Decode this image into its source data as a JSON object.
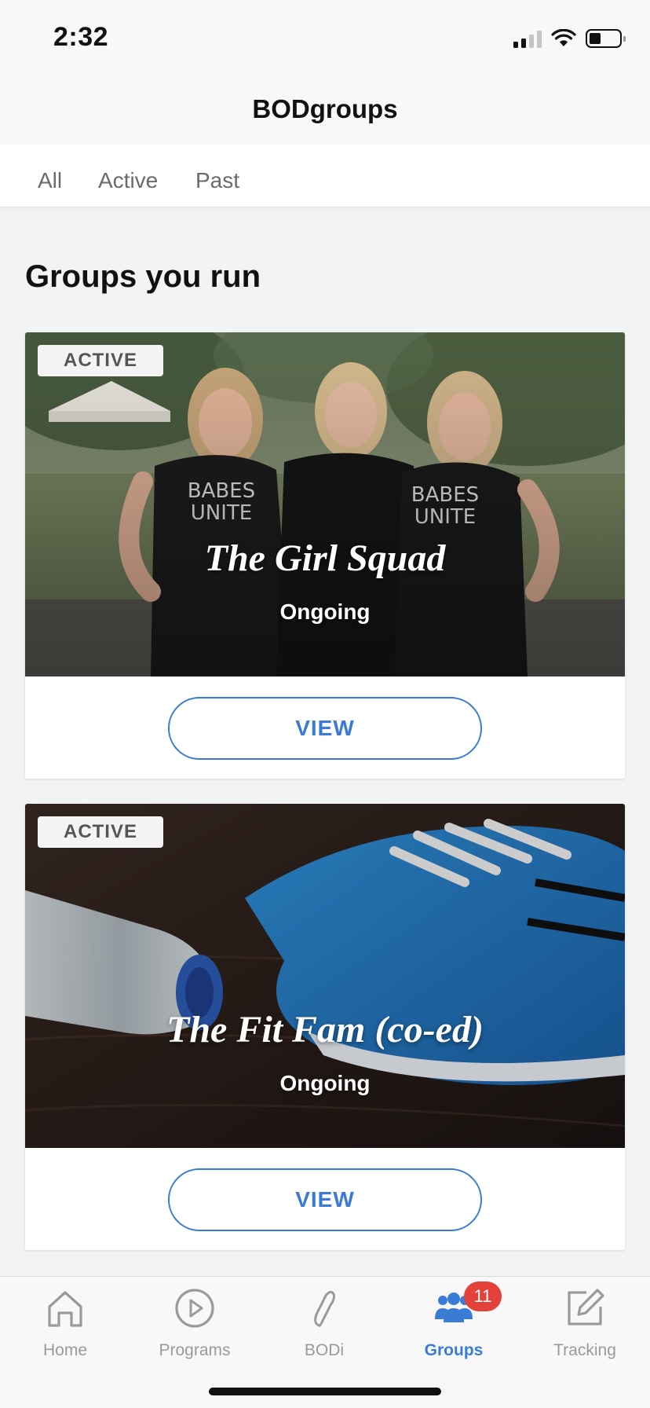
{
  "status_bar": {
    "time": "2:32"
  },
  "header": {
    "title": "BODgroups"
  },
  "filter_tabs": [
    "All",
    "Active",
    "Past"
  ],
  "section": {
    "title": "Groups you run"
  },
  "groups": [
    {
      "status_badge": "ACTIVE",
      "name": "The Girl Squad",
      "subtitle": "Ongoing",
      "button_label": "VIEW"
    },
    {
      "status_badge": "ACTIVE",
      "name": "The Fit Fam (co-ed)",
      "subtitle": "Ongoing",
      "button_label": "VIEW"
    }
  ],
  "tab_bar": {
    "items": [
      {
        "label": "Home",
        "icon": "home-icon"
      },
      {
        "label": "Programs",
        "icon": "play-circle-icon"
      },
      {
        "label": "BODi",
        "icon": "bodi-logo-icon"
      },
      {
        "label": "Groups",
        "icon": "groups-icon",
        "badge": "11",
        "active": true
      },
      {
        "label": "Tracking",
        "icon": "edit-icon"
      }
    ]
  },
  "colors": {
    "accent": "#3a7bd5",
    "badge_red": "#e5413b",
    "background": "#f2f3f5"
  }
}
